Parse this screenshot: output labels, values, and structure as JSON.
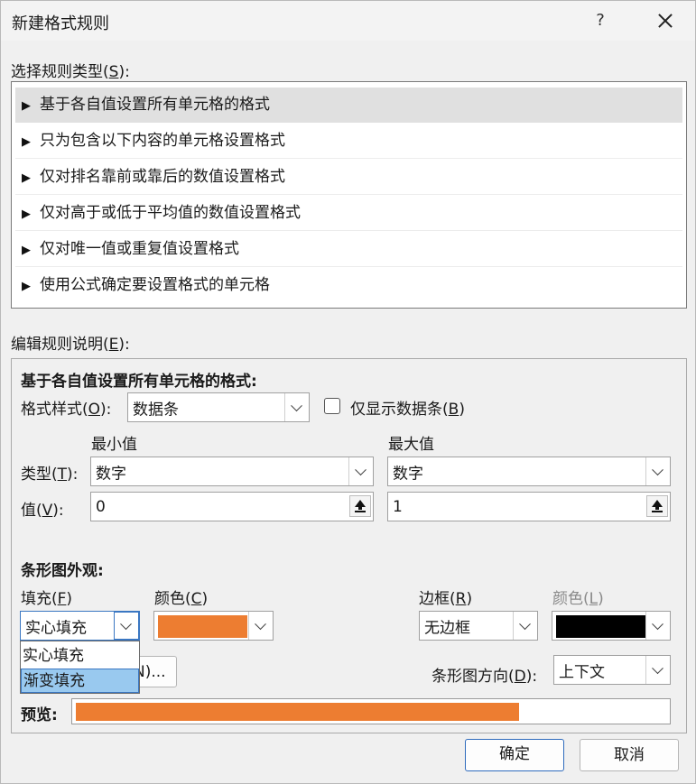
{
  "dialog": {
    "title": "新建格式规则",
    "help_label": "?"
  },
  "rule_type": {
    "label_prefix": "选择规则类型(",
    "label_key": "S",
    "label_suffix": "):",
    "items": [
      "基于各自值设置所有单元格的格式",
      "只为包含以下内容的单元格设置格式",
      "仅对排名靠前或靠后的数值设置格式",
      "仅对高于或低于平均值的数值设置格式",
      "仅对唯一值或重复值设置格式",
      "使用公式确定要设置格式的单元格"
    ],
    "selected_index": 0
  },
  "edit": {
    "label_prefix": "编辑规则说明(",
    "label_key": "E",
    "label_suffix": "):",
    "heading": "基于各自值设置所有单元格的格式:",
    "format_style": {
      "label_prefix": "格式样式(",
      "label_key": "O",
      "label_suffix": "):",
      "value": "数据条"
    },
    "show_bar_only": {
      "label_prefix": "仅显示数据条(",
      "label_key": "B",
      "label_suffix": ")",
      "checked": false
    },
    "min_header": "最小值",
    "max_header": "最大值",
    "type_label_prefix": "类型(",
    "type_label_key": "T",
    "type_label_suffix": "):",
    "value_label_prefix": "值(",
    "value_label_key": "V",
    "value_label_suffix": "):",
    "min_type": "数字",
    "max_type": "数字",
    "min_value": "0",
    "max_value": "1"
  },
  "bar_appearance": {
    "heading": "条形图外观:",
    "fill_label_prefix": "填充(",
    "fill_label_key": "F",
    "fill_label_suffix": ")",
    "fill_value": "实心填充",
    "fill_options": [
      "实心填充",
      "渐变填充"
    ],
    "fill_highlighted_index": 1,
    "color_label_prefix": "颜色(",
    "color_label_key": "C",
    "color_label_suffix": ")",
    "fill_color": "#ed7d31",
    "border_label_prefix": "边框(",
    "border_label_key": "R",
    "border_label_suffix": ")",
    "border_value": "无边框",
    "border_color_label_prefix": "颜色(",
    "border_color_label_key": "L",
    "border_color_label_suffix": ")",
    "border_color": "#000000",
    "negative_button_tail": "N)...",
    "direction_label_prefix": "条形图方向(",
    "direction_label_key": "D",
    "direction_label_suffix": "):",
    "direction_value": "上下文"
  },
  "preview": {
    "label": "预览:",
    "bar_color": "#ed7d31",
    "bar_fraction": 0.75
  },
  "buttons": {
    "ok": "确定",
    "cancel": "取消"
  }
}
